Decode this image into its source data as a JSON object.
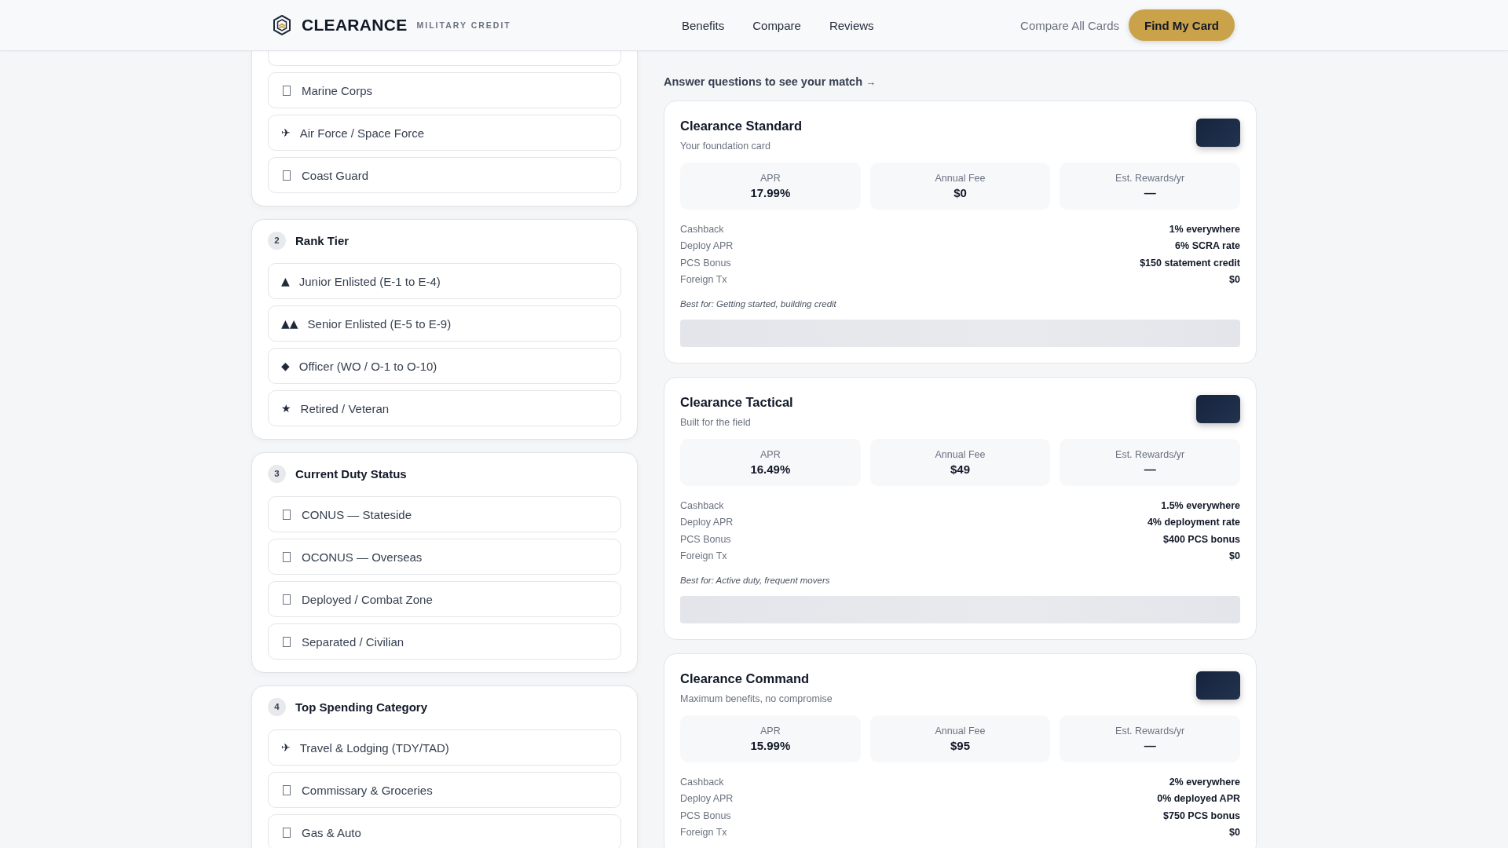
{
  "header": {
    "brand": "CLEARANCE",
    "tagline": "MILITARY CREDIT",
    "nav": [
      {
        "label": "Benefits"
      },
      {
        "label": "Compare"
      },
      {
        "label": "Reviews"
      }
    ],
    "link": "Compare All Cards",
    "cta": "Find My Card"
  },
  "questions": [
    {
      "items": [
        {
          "kind": "covered"
        },
        {
          "kind": "tofu",
          "label": "Marine Corps"
        },
        {
          "kind": "glyph",
          "icon": "✈",
          "label": "Air Force / Space Force"
        },
        {
          "kind": "tofu",
          "label": "Coast Guard"
        }
      ]
    },
    {
      "number": "2",
      "title": "Rank Tier",
      "items": [
        {
          "kind": "glyph",
          "icon": "▲",
          "label": "Junior Enlisted (E-1 to E-4)"
        },
        {
          "kind": "glyph",
          "icon": "▲▲",
          "label": "Senior Enlisted (E-5 to E-9)"
        },
        {
          "kind": "glyph",
          "icon": "◆",
          "label": "Officer (WO / O-1 to O-10)"
        },
        {
          "kind": "glyph",
          "icon": "★",
          "label": "Retired / Veteran"
        }
      ]
    },
    {
      "number": "3",
      "title": "Current Duty Status",
      "items": [
        {
          "kind": "tofu",
          "label": "CONUS — Stateside"
        },
        {
          "kind": "tofu",
          "label": "OCONUS — Overseas"
        },
        {
          "kind": "tofu",
          "label": "Deployed / Combat Zone"
        },
        {
          "kind": "tofu",
          "label": "Separated / Civilian"
        }
      ]
    },
    {
      "number": "4",
      "title": "Top Spending Category",
      "items": [
        {
          "kind": "glyph",
          "icon": "✈",
          "label": "Travel & Lodging (TDY/TAD)"
        },
        {
          "kind": "tofu",
          "label": "Commissary & Groceries"
        },
        {
          "kind": "tofu",
          "label": "Gas & Auto"
        }
      ]
    }
  ],
  "results": {
    "prompt": "Answer questions to see your match",
    "prompt_arrow": "→",
    "cards": [
      {
        "name": "Clearance Standard",
        "subtitle": "Your foundation card",
        "stats": [
          {
            "label": "APR",
            "value": "17.99%"
          },
          {
            "label": "Annual Fee",
            "value": "$0"
          },
          {
            "label": "Est. Rewards/yr",
            "value": "—"
          }
        ],
        "details": [
          {
            "label": "Cashback",
            "value": "1% everywhere"
          },
          {
            "label": "Deploy APR",
            "value": "6% SCRA rate"
          },
          {
            "label": "PCS Bonus",
            "value": "$150 statement credit"
          },
          {
            "label": "Foreign Tx",
            "value": "$0"
          }
        ],
        "best_for": "Best for: Getting started, building credit"
      },
      {
        "name": "Clearance Tactical",
        "subtitle": "Built for the field",
        "stats": [
          {
            "label": "APR",
            "value": "16.49%"
          },
          {
            "label": "Annual Fee",
            "value": "$49"
          },
          {
            "label": "Est. Rewards/yr",
            "value": "—"
          }
        ],
        "details": [
          {
            "label": "Cashback",
            "value": "1.5% everywhere"
          },
          {
            "label": "Deploy APR",
            "value": "4% deployment rate"
          },
          {
            "label": "PCS Bonus",
            "value": "$400 PCS bonus"
          },
          {
            "label": "Foreign Tx",
            "value": "$0"
          }
        ],
        "best_for": "Best for: Active duty, frequent movers"
      },
      {
        "name": "Clearance Command",
        "subtitle": "Maximum benefits, no compromise",
        "stats": [
          {
            "label": "APR",
            "value": "15.99%"
          },
          {
            "label": "Annual Fee",
            "value": "$95"
          },
          {
            "label": "Est. Rewards/yr",
            "value": "—"
          }
        ],
        "details": [
          {
            "label": "Cashback",
            "value": "2% everywhere"
          },
          {
            "label": "Deploy APR",
            "value": "0% deployed APR"
          },
          {
            "label": "PCS Bonus",
            "value": "$750 PCS bonus"
          },
          {
            "label": "Foreign Tx",
            "value": "$0"
          }
        ]
      }
    ]
  }
}
